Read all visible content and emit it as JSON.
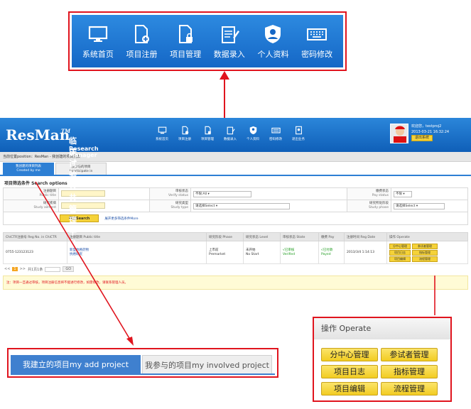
{
  "zoom_nav": {
    "items": [
      {
        "label": "系统首页",
        "icon": "monitor-icon"
      },
      {
        "label": "项目注册",
        "icon": "document-add-icon"
      },
      {
        "label": "项目管理",
        "icon": "document-lock-icon"
      },
      {
        "label": "数据录入",
        "icon": "notepad-pen-icon"
      },
      {
        "label": "个人资料",
        "icon": "user-shield-icon"
      },
      {
        "label": "密码修改",
        "icon": "keyboard-icon"
      }
    ]
  },
  "header": {
    "logo": "ResMan",
    "logo_tm": "TM",
    "title_cn": "临床试验公共管理平台",
    "title_en": "Research Manager",
    "nav": [
      "系统首页",
      "项目注册",
      "项目管理",
      "数据录入",
      "个人资料",
      "密码修改",
      "退出业务"
    ],
    "user": {
      "welcome": "欢迎您，testproj2",
      "datetime": "2013-03-21 16:32:24",
      "logout": "退出系统"
    }
  },
  "breadcrumb": "当前位置position：ResMan - 我创建的项目列表",
  "tabs": [
    {
      "label_cn": "我创建的项目列表",
      "label_en": "Created by me"
    },
    {
      "label_cn": "我参与的项目",
      "label_en": "I participate in"
    }
  ],
  "filter": {
    "title": "项目筛选条件 Search options",
    "fields": [
      {
        "label_cn": "注册题目",
        "label_en": "Public title"
      },
      {
        "label_cn": "审核状态",
        "label_en": "Verify status",
        "value": "不限:All"
      },
      {
        "label_cn": "缴费状态",
        "label_en": "Pay status",
        "value": "不限"
      },
      {
        "label_cn": "研究疾病",
        "label_en": "Study ailment"
      },
      {
        "label_cn": "研究类型",
        "label_en": "Study type",
        "value": "请选择Select"
      },
      {
        "label_cn": "研究所处阶段",
        "label_en": "Study phase",
        "value": "请选择Select"
      }
    ],
    "search_button": "筛选Search",
    "more_link": "展开更多筛选条件More"
  },
  "table": {
    "headers": [
      "ChiCTR注册号 Reg No. in ChiCTR",
      "注册题目 Public title",
      "研究阶段 Phase",
      "研究状态 Level",
      "审核状态 State",
      "缴费 Pay",
      "注册时间 Reg Date",
      "操作 Operate"
    ],
    "rows": [
      {
        "reg_no": "0755-123123123",
        "title_cn": "新型抗癌药物",
        "title_en": "抗癌研究",
        "phase_cn": "上市前",
        "phase_en": "Premarket",
        "level_cn": "未开始",
        "level_en": "No Start",
        "state_cn": "√已审核",
        "state_en": "Verified",
        "pay_cn": "√已付款",
        "pay_en": "Payed",
        "date": "2013/3/4 1:14:13"
      }
    ]
  },
  "pager": {
    "prev": "<<",
    "current": "1",
    "next": ">>",
    "info": "共1页1条",
    "go": "GO"
  },
  "note": "注：项目一旦通过审核，项目注册信息将不能进行修改，如需修改，请联系管理人员。",
  "zoom_tabs": {
    "active": "我建立的项目my add project",
    "inactive": "我参与的项目my involved project"
  },
  "zoom_ops": {
    "title": "操作 Operate",
    "buttons": [
      "分中心管理",
      "参试者管理",
      "项目日志",
      "指标管理",
      "项目编辑",
      "流程管理"
    ]
  }
}
